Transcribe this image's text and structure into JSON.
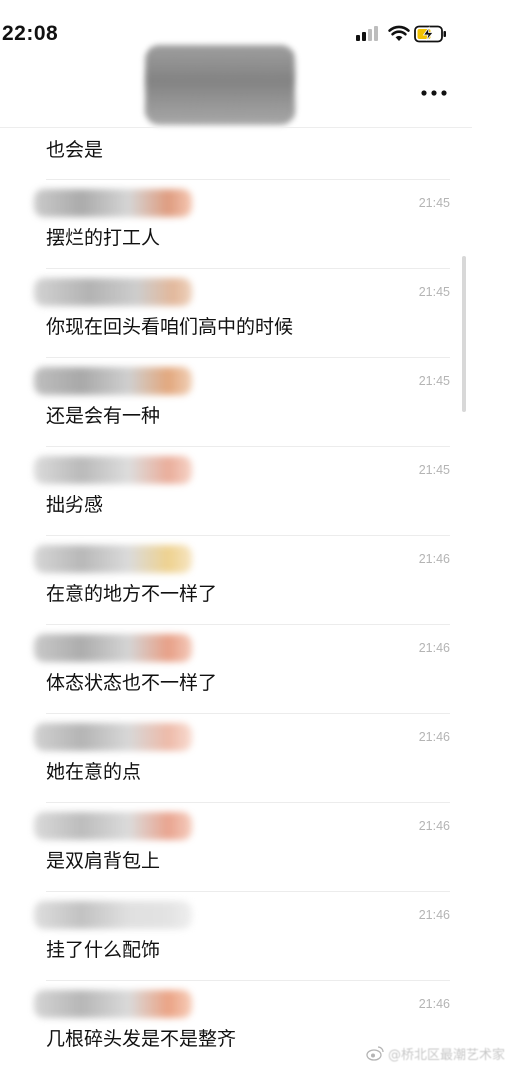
{
  "status_bar": {
    "time": "22:08",
    "icons": [
      "signal-icon",
      "wifi-icon",
      "battery-charging-icon"
    ]
  },
  "header": {
    "title_redacted": true,
    "more_label": "•••"
  },
  "messages": {
    "first_partial_text": "也会是",
    "items": [
      {
        "time": "21:45",
        "text": "摆烂的打工人"
      },
      {
        "time": "21:45",
        "text": "你现在回头看咱们高中的时候"
      },
      {
        "time": "21:45",
        "text": "还是会有一种"
      },
      {
        "time": "21:45",
        "text": "拙劣感"
      },
      {
        "time": "21:46",
        "text": "在意的地方不一样了"
      },
      {
        "time": "21:46",
        "text": "体态状态也不一样了"
      },
      {
        "time": "21:46",
        "text": "她在意的点"
      },
      {
        "time": "21:46",
        "text": "是双肩背包上"
      },
      {
        "time": "21:46",
        "text": "挂了什么配饰"
      },
      {
        "time": "21:46",
        "text": "几根碎头发是不是整齐"
      }
    ]
  },
  "watermark": {
    "icon": "weibo-icon",
    "text": "@桥北区最潮艺术家"
  },
  "colors": {
    "background": "#ffffff",
    "text": "#111111",
    "timestamp": "#b4b4b4",
    "divider": "#ececec",
    "battery_charge": "#f2c200"
  }
}
